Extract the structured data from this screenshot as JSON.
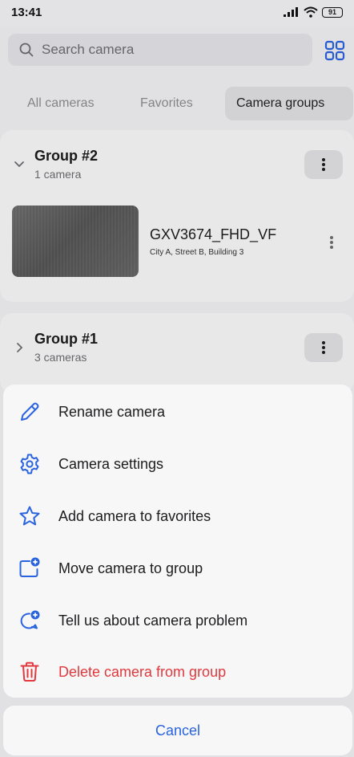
{
  "status_bar": {
    "time": "13:41",
    "battery": "91"
  },
  "search": {
    "placeholder": "Search camera"
  },
  "tabs": [
    {
      "label": "All cameras"
    },
    {
      "label": "Favorites"
    },
    {
      "label": "Camera groups"
    }
  ],
  "groups": [
    {
      "title": "Group #2",
      "subtitle": "1 camera",
      "cameras": [
        {
          "name": "GXV3674_FHD_VF",
          "location": "City A, Street B, Building 3"
        }
      ]
    },
    {
      "title": "Group #1",
      "subtitle": "3 cameras"
    }
  ],
  "action_sheet": {
    "items": [
      {
        "label": "Rename camera",
        "icon": "pencil-icon"
      },
      {
        "label": "Camera settings",
        "icon": "gear-icon"
      },
      {
        "label": "Add camera to favorites",
        "icon": "star-icon"
      },
      {
        "label": "Move camera to group",
        "icon": "folder-plus-icon"
      },
      {
        "label": "Tell us about camera problem",
        "icon": "chat-plus-icon"
      },
      {
        "label": "Delete camera from group",
        "icon": "trash-icon"
      }
    ],
    "cancel_label": "Cancel"
  },
  "colors": {
    "accent": "#2a63e0",
    "danger": "#e0393e"
  }
}
